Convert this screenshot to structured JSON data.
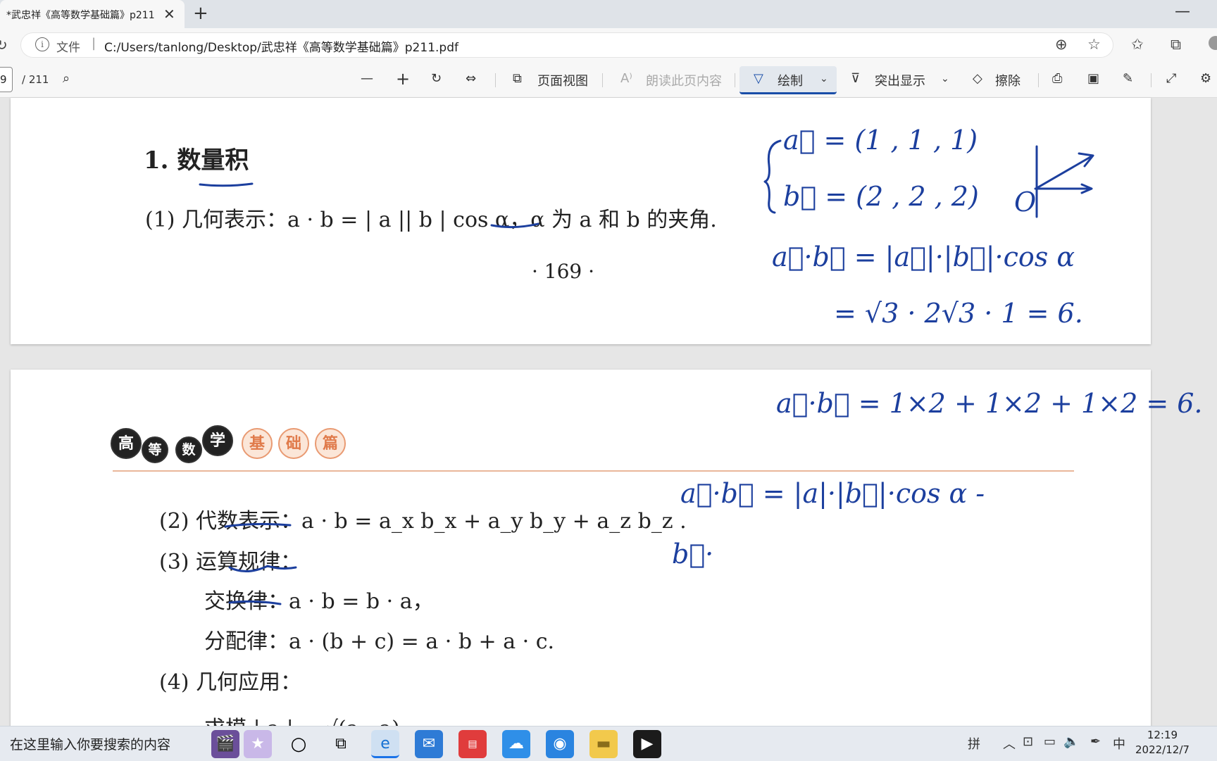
{
  "browser": {
    "tab_title": "*武忠祥《高等数学基础篇》p211",
    "address_label": "文件",
    "url": "C:/Users/tanlong/Desktop/武忠祥《高等数学基础篇》p211.pdf"
  },
  "pdf_toolbar": {
    "page_current": "9",
    "page_total": "/ 211",
    "page_view": "页面视图",
    "read_aloud": "朗读此页内容",
    "draw": "绘制",
    "highlight": "突出显示",
    "erase": "擦除"
  },
  "page1": {
    "section_num": "1.",
    "section_title": "数量积",
    "geom_repr": "(1) 几何表示：a · b = | a || b | cos α，α 为 a 和 b 的夹角.",
    "page_number": "· 169 ·"
  },
  "page2": {
    "banner_chars": [
      "高",
      "等",
      "数",
      "学",
      "基",
      "础",
      "篇"
    ],
    "alg_repr": "(2) 代数表示：a · b = a_x b_x + a_y b_y + a_z b_z .",
    "laws_title": "(3) 运算规律：",
    "commutative": "交换律：a · b = b · a，",
    "distributive": "分配律：a · (b + c) = a · b + a · c.",
    "applications": "(4) 几何应用：",
    "modulus": "求模 | a | = √(a · a)"
  },
  "handwriting": {
    "vec_a": "a⃗ = (1 , 1 , 1)",
    "vec_b": "b⃗ = (2 , 2 , 2)",
    "dot_geom": "a⃗·b⃗ = |a⃗|·|b⃗|·cos α",
    "dot_geom_result": "= √3 · 2√3 · 1 = 6.",
    "origin": "O",
    "dot_alg": "a⃗·b⃗ = 1×2 + 1×2 + 1×2 = 6.",
    "dot_geom2": "a⃗·b⃗ = |a|·|b⃗|·cos α -",
    "b_vec": "b⃗·"
  },
  "taskbar": {
    "search_placeholder": "在这里输入你要搜索的内容",
    "ime_mode": "拼",
    "ime_lang": "中",
    "time": "12:19",
    "date": "2022/12/7"
  },
  "colors": {
    "ink": "#1c3f9e",
    "accent": "#1a4ea8"
  }
}
